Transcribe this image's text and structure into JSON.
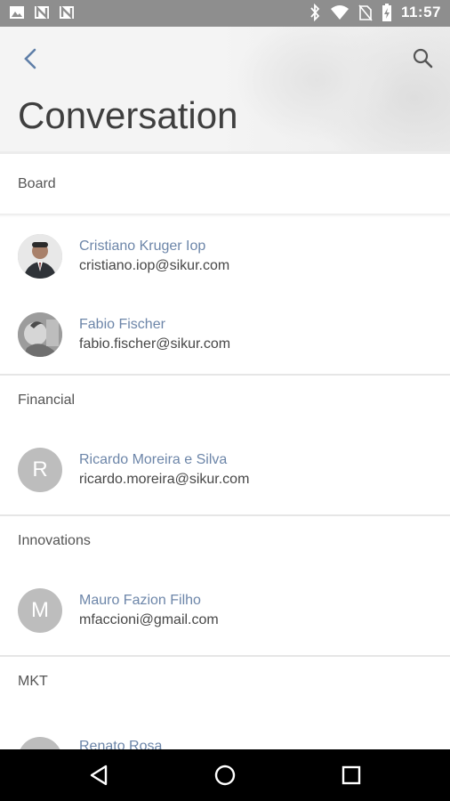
{
  "status_bar": {
    "time": "11:57",
    "left_icons": [
      "image-icon",
      "n-notification-icon",
      "n-notification-icon"
    ],
    "right_icons": [
      "bluetooth-icon",
      "wifi-icon",
      "no-sim-icon",
      "battery-charging-icon"
    ]
  },
  "header": {
    "title": "Conversation",
    "back_icon": "arrow-back-icon",
    "search_icon": "search-icon"
  },
  "sections": [
    {
      "label": "Board",
      "contacts": [
        {
          "name": "Cristiano Kruger Iop",
          "email": "cristiano.iop@sikur.com",
          "avatar": "photo"
        },
        {
          "name": "Fabio Fischer",
          "email": "fabio.fischer@sikur.com",
          "avatar": "photo"
        }
      ]
    },
    {
      "label": "Financial",
      "contacts": [
        {
          "name": "Ricardo Moreira e Silva",
          "email": "ricardo.moreira@sikur.com",
          "avatar": "R"
        }
      ]
    },
    {
      "label": "Innovations",
      "contacts": [
        {
          "name": "Mauro Fazion Filho",
          "email": "mfaccioni@gmail.com",
          "avatar": "M"
        }
      ]
    },
    {
      "label": "MKT",
      "contacts": [
        {
          "name": "Renato Rosa",
          "email": "",
          "avatar": ""
        }
      ]
    }
  ],
  "nav_bar": {
    "back": "triangle-back-icon",
    "home": "circle-home-icon",
    "recents": "square-recents-icon"
  }
}
